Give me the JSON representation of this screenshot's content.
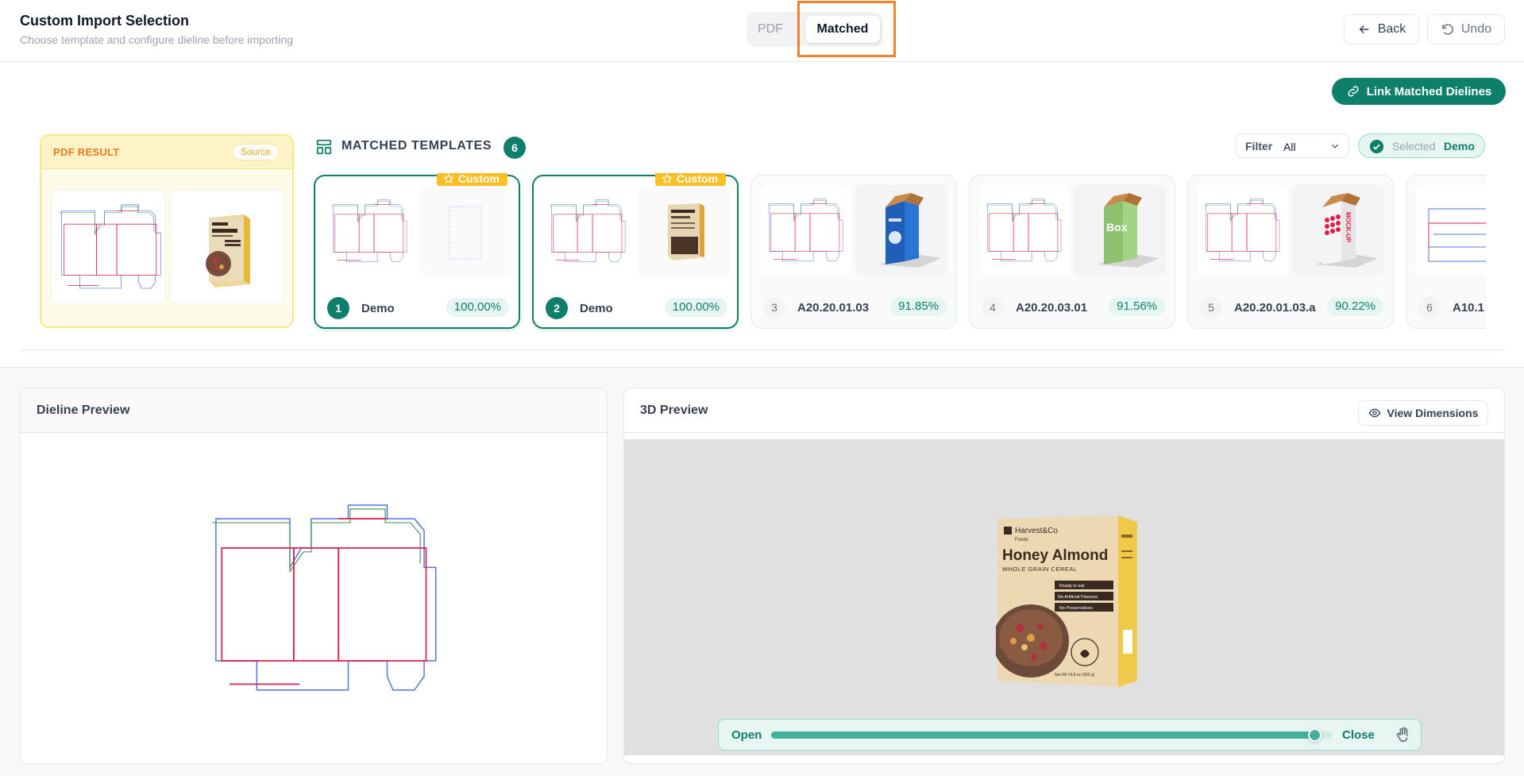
{
  "header": {
    "title": "Custom Import Selection",
    "subtitle": "Choose template and configure dieline before importing",
    "tabs": [
      "PDF",
      "Matched"
    ],
    "back_label": "Back",
    "undo_label": "Undo"
  },
  "toolbar": {
    "link_label": "Link Matched Dielines"
  },
  "pdf_result": {
    "label": "PDF RESULT",
    "badge": "Source"
  },
  "matched": {
    "label": "MATCHED TEMPLATES",
    "count": "6",
    "filter_label": "Filter",
    "filter_value": "All",
    "selected_label": "Selected",
    "selected_value": "Demo",
    "custom_badge": "Custom",
    "cards": [
      {
        "num": "1",
        "name": "Demo",
        "score": "100.00%",
        "custom": true,
        "selected": true
      },
      {
        "num": "2",
        "name": "Demo",
        "score": "100.00%",
        "custom": true,
        "selected": true
      },
      {
        "num": "3",
        "name": "A20.20.01.03",
        "score": "91.85%",
        "custom": false
      },
      {
        "num": "4",
        "name": "A20.20.03.01",
        "score": "91.56%",
        "custom": false,
        "product_text": "Box"
      },
      {
        "num": "5",
        "name": "A20.20.01.03.a",
        "score": "90.22%",
        "custom": false,
        "product_text": "MOCK-UP"
      },
      {
        "num": "6",
        "name": "A10.1",
        "score": "",
        "custom": false
      }
    ]
  },
  "dieline_preview": {
    "title": "Dieline Preview"
  },
  "preview3d": {
    "title": "3D Preview",
    "view_dimensions": "View Dimensions",
    "slider_open": "Open",
    "slider_close": "Close",
    "slider_value": 0.97
  },
  "product": {
    "brand": "Harvest&Co",
    "brand_sub": "Foods",
    "name": "Honey Almond",
    "tagline": "WHOLE GRAIN CEREAL",
    "badges": [
      "Ready to eat",
      "No Artificial Flavours",
      "No Preservatives"
    ],
    "net_wt": "Net Wt 14.8 oz (420 g)"
  },
  "colors": {
    "accent": "#0e7f6b",
    "custom": "#fbbf24",
    "pdf_border": "#fde68a",
    "highlight": "#f5822a",
    "cut_line": "#3b5bdb",
    "fold_line": "#e11d48"
  }
}
